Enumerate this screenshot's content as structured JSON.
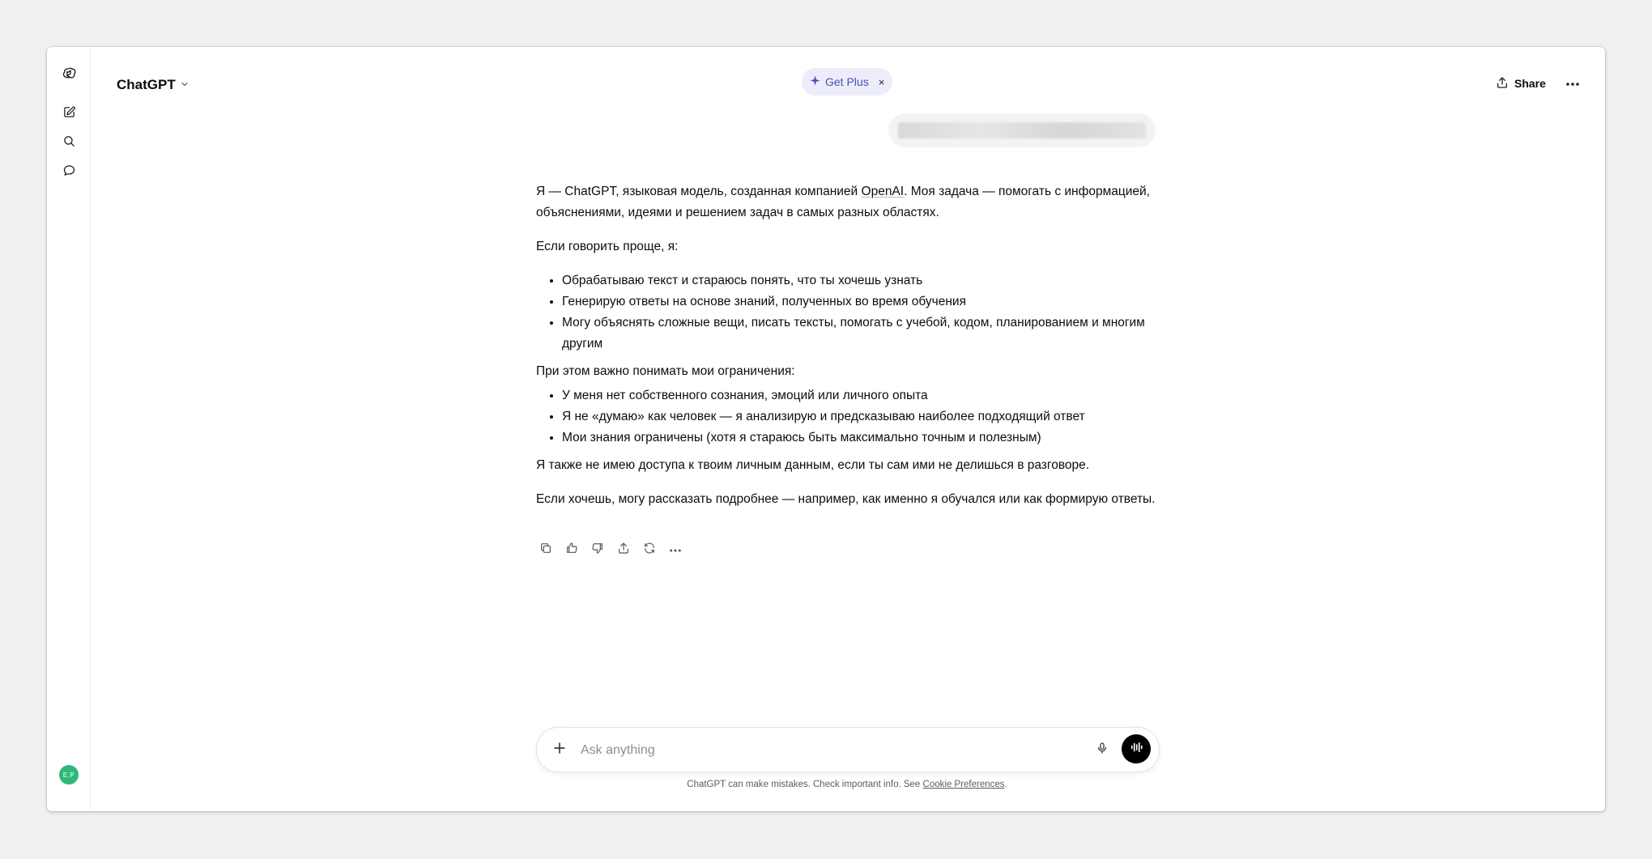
{
  "app": {
    "model_name": "ChatGPT",
    "get_plus_label": "Get Plus",
    "get_plus_close": "×",
    "share_label": "Share"
  },
  "sidebar": {
    "icons": [
      "openai-logo-icon",
      "new-chat-icon",
      "search-icon",
      "chats-icon"
    ],
    "avatar_initials": "E.P"
  },
  "conversation": {
    "assistant": {
      "p1_before_link": "Я — ChatGPT, языковая модель, созданная компанией ",
      "p1_link": "OpenAI",
      "p1_after_link": ". Моя задача — помогать с информацией, объяснениями, идеями и решением задач в самых разных областях.",
      "p2": "Если говорить проще, я:",
      "list1": [
        "Обрабатываю текст и стараюсь понять, что ты хочешь узнать",
        "Генерирую ответы на основе знаний, полученных во время обучения",
        "Могу объяснять сложные вещи, писать тексты, помогать с учебой, кодом, планированием и многим другим"
      ],
      "p3": "При этом важно понимать мои ограничения:",
      "list2": [
        "У меня нет собственного сознания, эмоций или личного опыта",
        "Я не «думаю» как человек — я анализирую и предсказываю наиболее подходящий ответ",
        "Мои знания ограничены (хотя я стараюсь быть максимально точным и полезным)"
      ],
      "p4": "Я также не имею доступа к твоим личным данным, если ты сам ими не делишься в разговоре.",
      "p5": "Если хочешь, могу рассказать подробнее — например, как именно я обучался или как формирую ответы."
    },
    "actions": [
      "copy-icon",
      "thumbs-up-icon",
      "thumbs-down-icon",
      "share-icon",
      "regenerate-icon",
      "more-icon"
    ]
  },
  "composer": {
    "placeholder": "Ask anything",
    "value": ""
  },
  "footer": {
    "disclaimer_text": "ChatGPT can make mistakes. Check important info. See ",
    "cookie_link": "Cookie Preferences",
    "period": "."
  },
  "colors": {
    "accent_plus": "#4a4fb3",
    "avatar": "#2fb87a"
  }
}
